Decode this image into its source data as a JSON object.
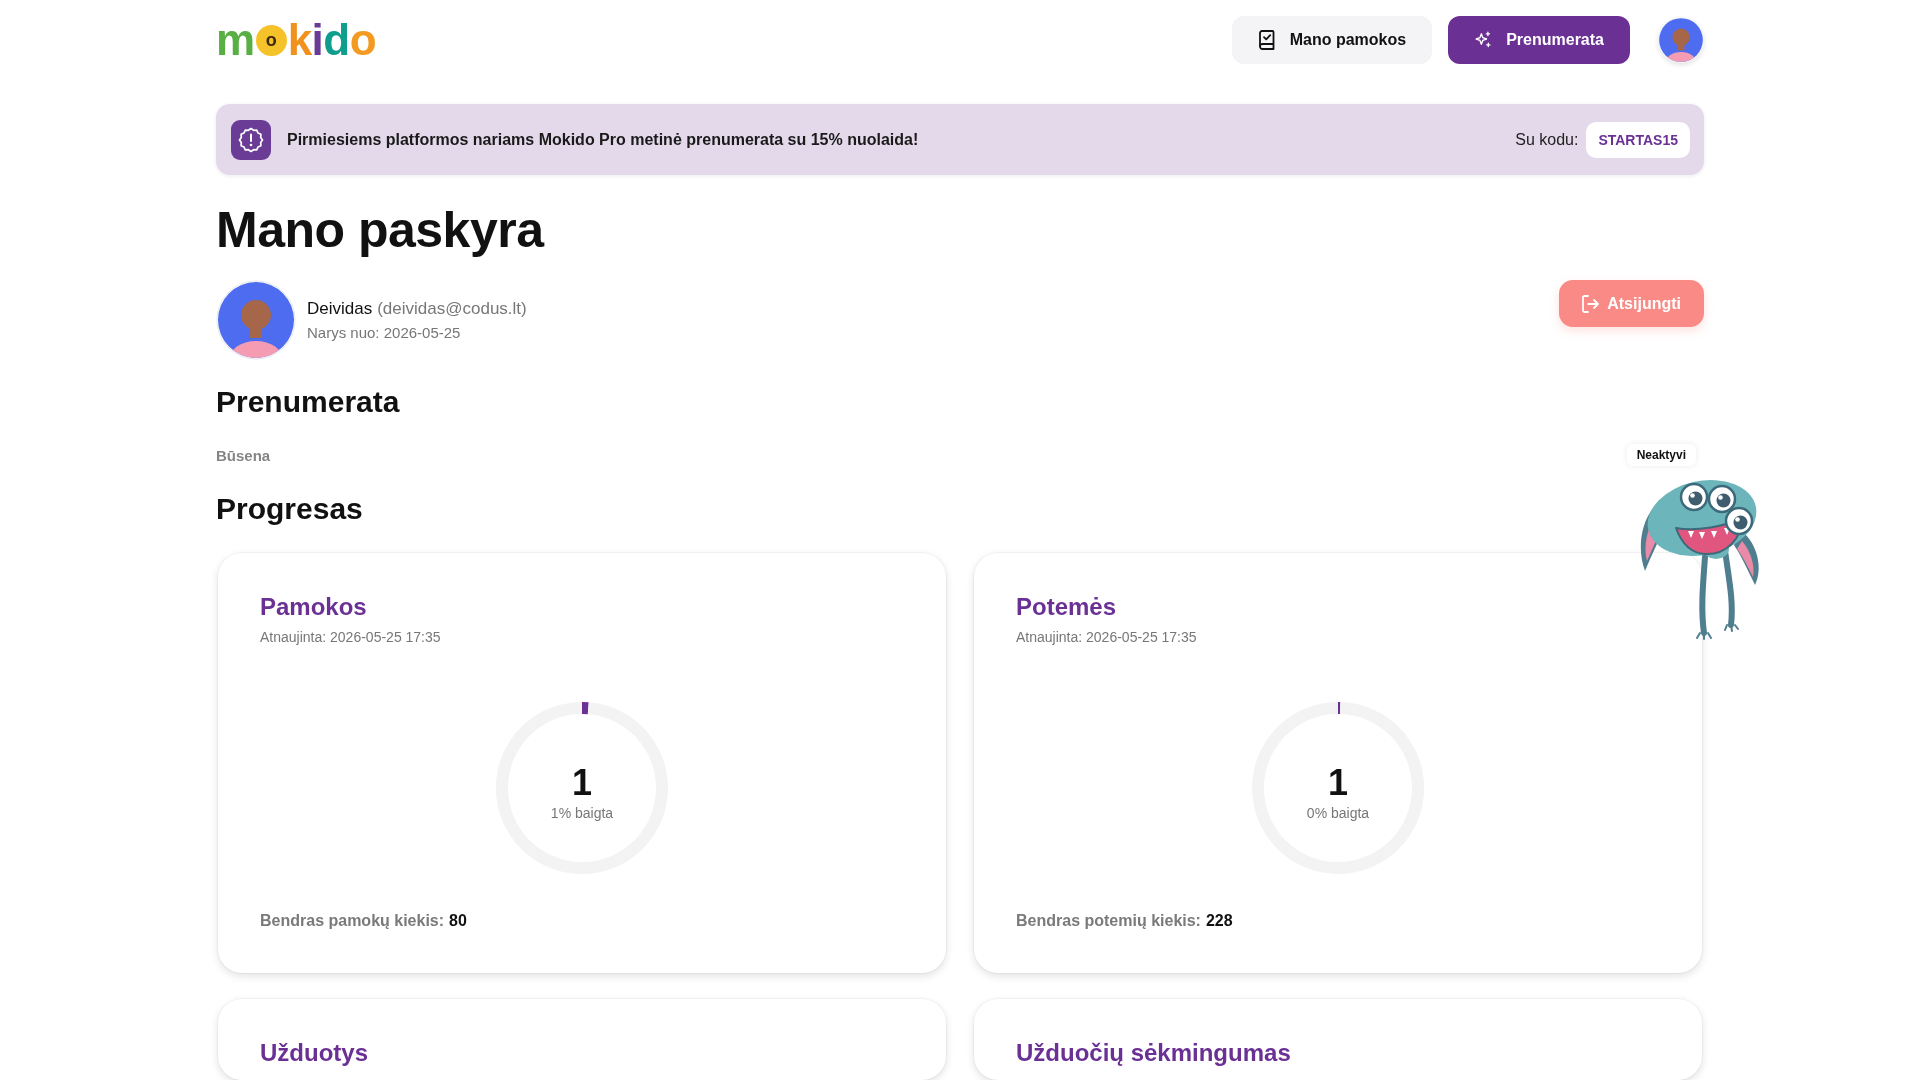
{
  "header": {
    "logo": "mokido",
    "nav": [
      {
        "label": "Mano pamokos",
        "kind": "secondary"
      },
      {
        "label": "Prenumerata",
        "kind": "primary"
      }
    ]
  },
  "banner": {
    "message": "Pirmiesiems platformos nariams Mokido Pro metinė prenumerata su 15% nuolaida!",
    "code_label": "Su kodu:",
    "code": "STARTAS15"
  },
  "account": {
    "title": "Mano paskyra",
    "user_name": "Deividas",
    "email": "(deividas@codus.lt)",
    "member_since": "Narys nuo: 2026-05-25",
    "logout_button": "Atsijungti"
  },
  "subscription": {
    "title": "Prenumerata",
    "status_label": "Būsena",
    "status": "Neaktyvi"
  },
  "progress": {
    "title": "Progresas",
    "cards": [
      {
        "title": "Pamokos",
        "updated": "Atnaujinta: 2026-05-25 17:35",
        "chart_data": {
          "type": "donut",
          "values": [
            1.25,
            98.75
          ]
        },
        "count": "1",
        "percent_label": "1% baigta",
        "total_label": "Bendras pamokų kiekis:",
        "total": "80"
      },
      {
        "title": "Potemės",
        "updated": "Atnaujinta: 2026-05-25 17:35",
        "chart_data": {
          "type": "donut",
          "values": [
            0.44,
            99.56
          ]
        },
        "count": "1",
        "percent_label": "0% baigta",
        "total_label": "Bendras potemių kiekis:",
        "total": "228"
      },
      {
        "title": "Užduotys"
      },
      {
        "title": "Užduočių sėkmingumas"
      }
    ]
  }
}
